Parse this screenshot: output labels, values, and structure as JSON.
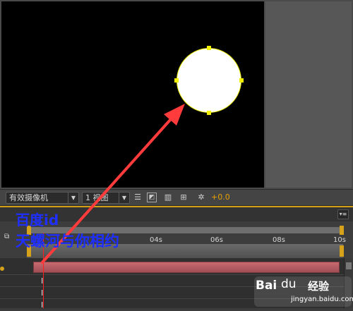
{
  "viewer": {
    "camera_label": "有效摄像机",
    "views_label": "1 视图",
    "exposure_value": "+0.0"
  },
  "timeline": {
    "menu_icon": "panel-menu-icon",
    "ticks": [
      "04s",
      "06s",
      "08s",
      "10s"
    ],
    "keyframe_glyph": "I"
  },
  "watermarks": {
    "line1": "百度id",
    "line2": "天螺河与你相约"
  },
  "branding": {
    "logo_text": "Bai",
    "logo_paw": "du",
    "logo_cn": "经验",
    "logo_url": "jingyan.baidu.com"
  },
  "colors": {
    "arrow": "#ff3b3b",
    "watermark": "#1f2fff",
    "accent": "#d6a21a",
    "layer_bar": "#b85a60"
  }
}
